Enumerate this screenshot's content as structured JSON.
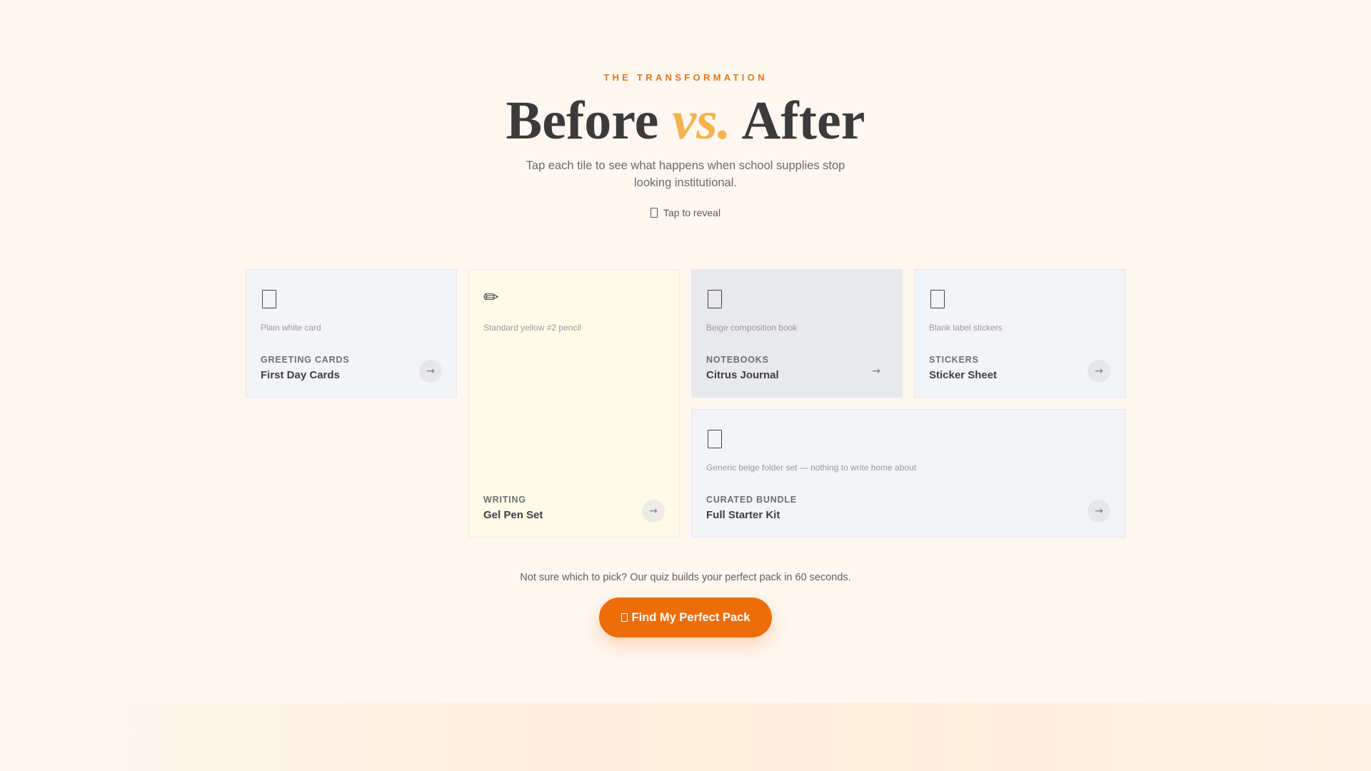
{
  "header": {
    "eyebrow": "THE TRANSFORMATION",
    "headline_before": "Before",
    "headline_vs": "vs.",
    "headline_after": "After",
    "subtitle": "Tap each tile to see what happens when school supplies stop looking institutional.",
    "hint": "Tap to reveal",
    "hint_icon": "phone-icon"
  },
  "tiles": [
    {
      "icon": "card-icon",
      "description": "Plain white card",
      "category": "GREETING CARDS",
      "name": "First Day Cards",
      "arrow": "→"
    },
    {
      "icon": "pencil-icon",
      "icon_glyph": "✏",
      "description": "Standard yellow #2 pencil",
      "category": "WRITING",
      "name": "Gel Pen Set",
      "arrow": "→"
    },
    {
      "icon": "notebook-icon",
      "description": "Beige composition book",
      "category": "NOTEBOOKS",
      "name": "Citrus Journal",
      "arrow": "→"
    },
    {
      "icon": "sticker-icon",
      "description": "Blank label stickers",
      "category": "STICKERS",
      "name": "Sticker Sheet",
      "arrow": "→"
    },
    {
      "icon": "folder-icon",
      "description": "Generic beige folder set — nothing to write home about",
      "category": "CURATED BUNDLE",
      "name": "Full Starter Kit",
      "arrow": "→"
    }
  ],
  "cta": {
    "text": "Not sure which to pick? Our quiz builds your perfect pack in 60 seconds.",
    "button_label": "Find My Perfect Pack",
    "button_icon": "sparkle-icon"
  },
  "colors": {
    "accent": "#ee6d0b",
    "eyebrow": "#e8771a",
    "vs": "#f6b24e",
    "background": "#fff7f0"
  }
}
